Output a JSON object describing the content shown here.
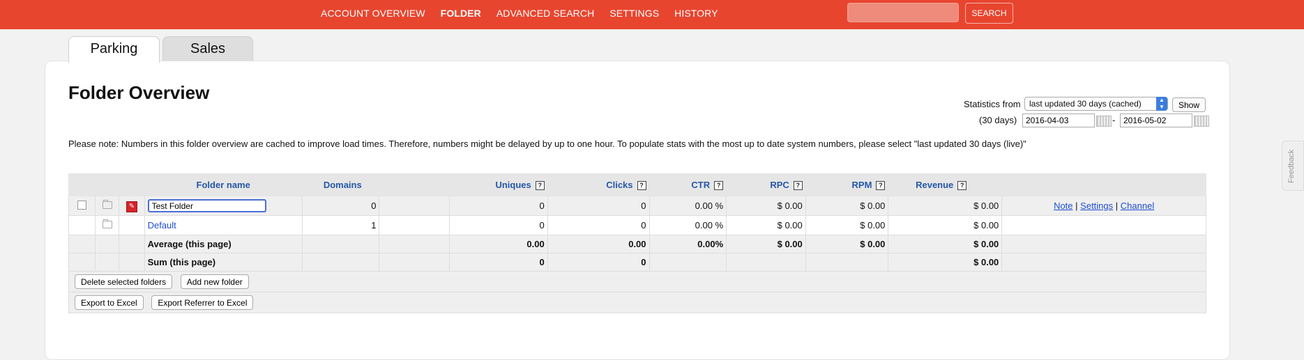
{
  "nav": {
    "items": [
      "ACCOUNT OVERVIEW",
      "FOLDER",
      "ADVANCED SEARCH",
      "SETTINGS",
      "HISTORY"
    ],
    "active": "FOLDER",
    "search_button": "SEARCH",
    "search_value": ""
  },
  "tabs": [
    "Parking",
    "Sales"
  ],
  "page": {
    "title": "Folder Overview",
    "note": "Please note: Numbers in this folder overview are cached to improve load times. Therefore, numbers might be delayed by up to one hour. To populate stats with the most up to date system numbers, please select \"last updated 30 days (live)\""
  },
  "stats": {
    "label": "Statistics from",
    "selected": "last updated 30 days (cached)",
    "show_button": "Show",
    "days_label": "(30 days)",
    "date_from": "2016-04-03",
    "date_to": "2016-05-02",
    "dash": "-"
  },
  "table": {
    "headers": {
      "folder_name": "Folder name",
      "domains": "Domains",
      "uniques": "Uniques",
      "clicks": "Clicks",
      "ctr": "CTR",
      "rpc": "RPC",
      "rpm": "RPM",
      "revenue": "Revenue"
    },
    "help_glyph": "?",
    "rows": [
      {
        "name": "Test Folder",
        "domains": "0",
        "uniques": "0",
        "clicks": "0",
        "ctr": "0.00 %",
        "rpc": "$ 0.00",
        "rpm": "$ 0.00",
        "revenue": "$ 0.00",
        "actions": [
          "Note",
          "Settings",
          "Channel"
        ],
        "separator": "|"
      },
      {
        "name": "Default",
        "domains": "1",
        "uniques": "0",
        "clicks": "0",
        "ctr": "0.00 %",
        "rpc": "$ 0.00",
        "rpm": "$ 0.00",
        "revenue": "$ 0.00"
      }
    ],
    "average": {
      "label": "Average (this page)",
      "uniques": "0.00",
      "clicks": "0.00",
      "ctr": "0.00%",
      "rpc": "$ 0.00",
      "rpm": "$ 0.00",
      "revenue": "$ 0.00"
    },
    "sum": {
      "label": "Sum (this page)",
      "uniques": "0",
      "clicks": "0",
      "revenue": "$ 0.00"
    }
  },
  "buttons": {
    "delete": "Delete selected folders",
    "add": "Add new folder",
    "export": "Export to Excel",
    "export_referrer": "Export Referrer to Excel"
  },
  "feedback": "Feedback",
  "colors": {
    "brand": "#e8452f",
    "link": "#1f4ecf",
    "header_text": "#2557a7"
  }
}
